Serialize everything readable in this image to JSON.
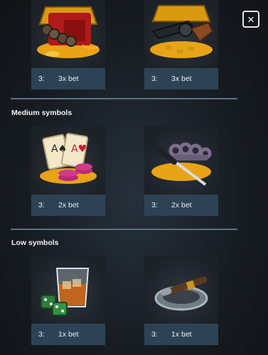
{
  "close_label": "×",
  "sections": [
    {
      "title": ""
    },
    {
      "title": "Medium symbols"
    },
    {
      "title": "Low symbols"
    }
  ],
  "symbols": [
    {
      "icon": "dynamite-bundle-icon",
      "count": "3:",
      "payout": "3x bet"
    },
    {
      "icon": "revolver-icon",
      "count": "3:",
      "payout": "3x bet"
    },
    {
      "icon": "cards-and-chips-icon",
      "count": "3:",
      "payout": "2x bet"
    },
    {
      "icon": "knuckles-and-knife-icon",
      "count": "3:",
      "payout": "2x bet"
    },
    {
      "icon": "whiskey-and-dice-icon",
      "count": "3:",
      "payout": "1x bet"
    },
    {
      "icon": "cigar-ashtray-icon",
      "count": "3:",
      "payout": "1x bet"
    }
  ],
  "colors": {
    "background": "#15191d",
    "payline_bar": "#2d4355",
    "divider": "#5a7183",
    "gold": "#e8a317"
  }
}
